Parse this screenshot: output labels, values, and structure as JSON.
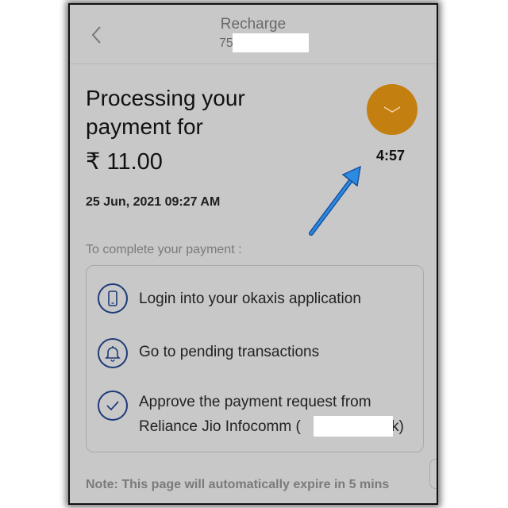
{
  "header": {
    "title": "Recharge",
    "subtitle_prefix": "75"
  },
  "payment": {
    "title": "Processing your payment for",
    "amount": "₹ 11.00",
    "datetime": "25 Jun, 2021 09:27 AM",
    "timer": "4:57"
  },
  "instructions": {
    "label": "To complete your payment :",
    "steps": [
      {
        "icon": "phone-icon",
        "text": "Login into your okaxis application"
      },
      {
        "icon": "bell-icon",
        "text": "Go to pending transactions"
      },
      {
        "icon": "check-icon",
        "text_line1": "Approve the payment request from",
        "text_line2_prefix": "Reliance Jio Infocomm (",
        "text_line2_suffix": "k)"
      }
    ]
  },
  "note": "Note: This page will automatically expire in 5 mins",
  "colors": {
    "accent": "#c47f11",
    "icon_blue": "#1f3b78",
    "annotation_arrow": "#2a8be0"
  }
}
